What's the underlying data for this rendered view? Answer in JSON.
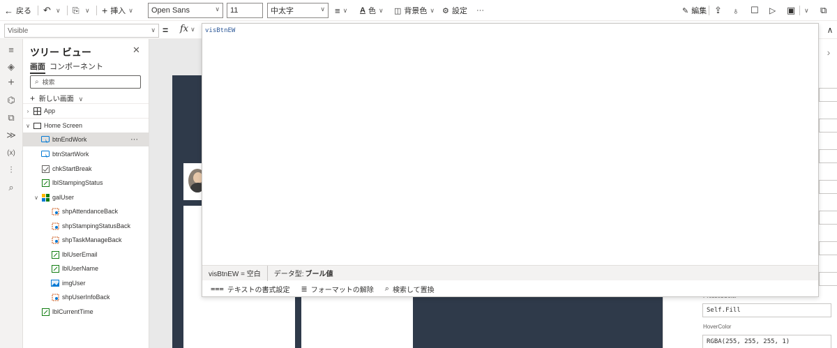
{
  "toolbar": {
    "back": "戻る",
    "insert": "挿入",
    "font": "Open Sans",
    "font_size": "11",
    "font_weight": "中太字",
    "color": "色",
    "fill": "背景色",
    "settings": "設定",
    "more": "···",
    "edit": "編集"
  },
  "formula_bar": {
    "property": "Visible",
    "equals": "=",
    "fx": "fx"
  },
  "tree": {
    "title": "ツリー ビュー",
    "tabs": [
      "画面",
      "コンポーネント"
    ],
    "search_placeholder": "検索",
    "new_screen": "新しい画面",
    "items": [
      {
        "label": "App",
        "icon": "app-icon"
      },
      {
        "label": "Home Screen",
        "icon": "screen-icon"
      },
      {
        "label": "btnEndWork",
        "icon": "button-icon",
        "more": "···"
      },
      {
        "label": "btnStartWork",
        "icon": "button-icon"
      },
      {
        "label": "chkStartBreak",
        "icon": "checkbox-icon"
      },
      {
        "label": "lblStampingStatus",
        "icon": "label-icon"
      },
      {
        "label": "galUser",
        "icon": "gallery-icon"
      },
      {
        "label": "shpAttendanceBack",
        "icon": "shape-icon"
      },
      {
        "label": "shpStampingStatusBack",
        "icon": "shape-icon"
      },
      {
        "label": "shpTaskManageBack",
        "icon": "shape-icon"
      },
      {
        "label": "lblUserEmail",
        "icon": "label-icon"
      },
      {
        "label": "lblUserName",
        "icon": "label-icon"
      },
      {
        "label": "imgUser",
        "icon": "image-icon"
      },
      {
        "label": "shpUserInfoBack",
        "icon": "shape-icon"
      },
      {
        "label": "lblCurrentTime",
        "icon": "label-icon"
      }
    ]
  },
  "editor": {
    "code": "visBtnEW",
    "result": "visBtnEW  =  空白",
    "data_type_label": "データ型:",
    "data_type_value": "ブール値",
    "format_text": "テキストの書式設定",
    "remove_format": "フォーマットの解除",
    "find_replace": "検索して置換"
  },
  "properties": {
    "pressed_label": "PressedColor",
    "pressed_value": "Self.Fill",
    "hover_label": "HoverColor",
    "hover_value": "RGBA(255, 255, 255, 1)"
  },
  "colors": {
    "screen_bg": "#2f3a4a",
    "code_text": "#2b5797",
    "selected_row": "#e1dfdd"
  }
}
